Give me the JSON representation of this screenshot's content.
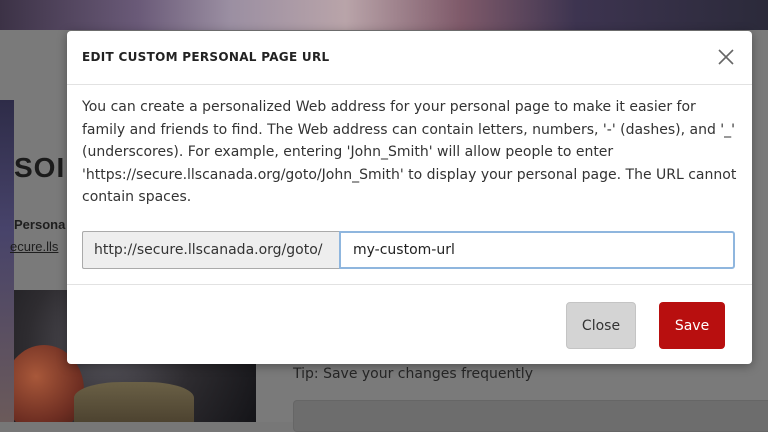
{
  "background": {
    "heading_fragment": "SOI",
    "sub_fragment": "Persona",
    "link_fragment": "ecure.lls",
    "tip": "Tip: Save your changes frequently"
  },
  "modal": {
    "title": "EDIT CUSTOM PERSONAL PAGE URL",
    "description": "You can create a personalized Web address for your personal page to make it easier for family and friends to find. The Web address can contain letters, numbers, '-' (dashes), and '_' (underscores). For example, entering 'John_Smith' will allow people to enter 'https://secure.llscanada.org/goto/John_Smith' to display your personal page. The URL cannot contain spaces.",
    "url_prefix": "http://secure.llscanada.org/goto/",
    "url_value": "my-custom-url",
    "close_label": "Close",
    "save_label": "Save",
    "close_icon": "close-icon"
  },
  "colors": {
    "save_button": "#b80f0f",
    "close_button": "#d4d4d4",
    "input_focus_border": "#8fb6de"
  }
}
